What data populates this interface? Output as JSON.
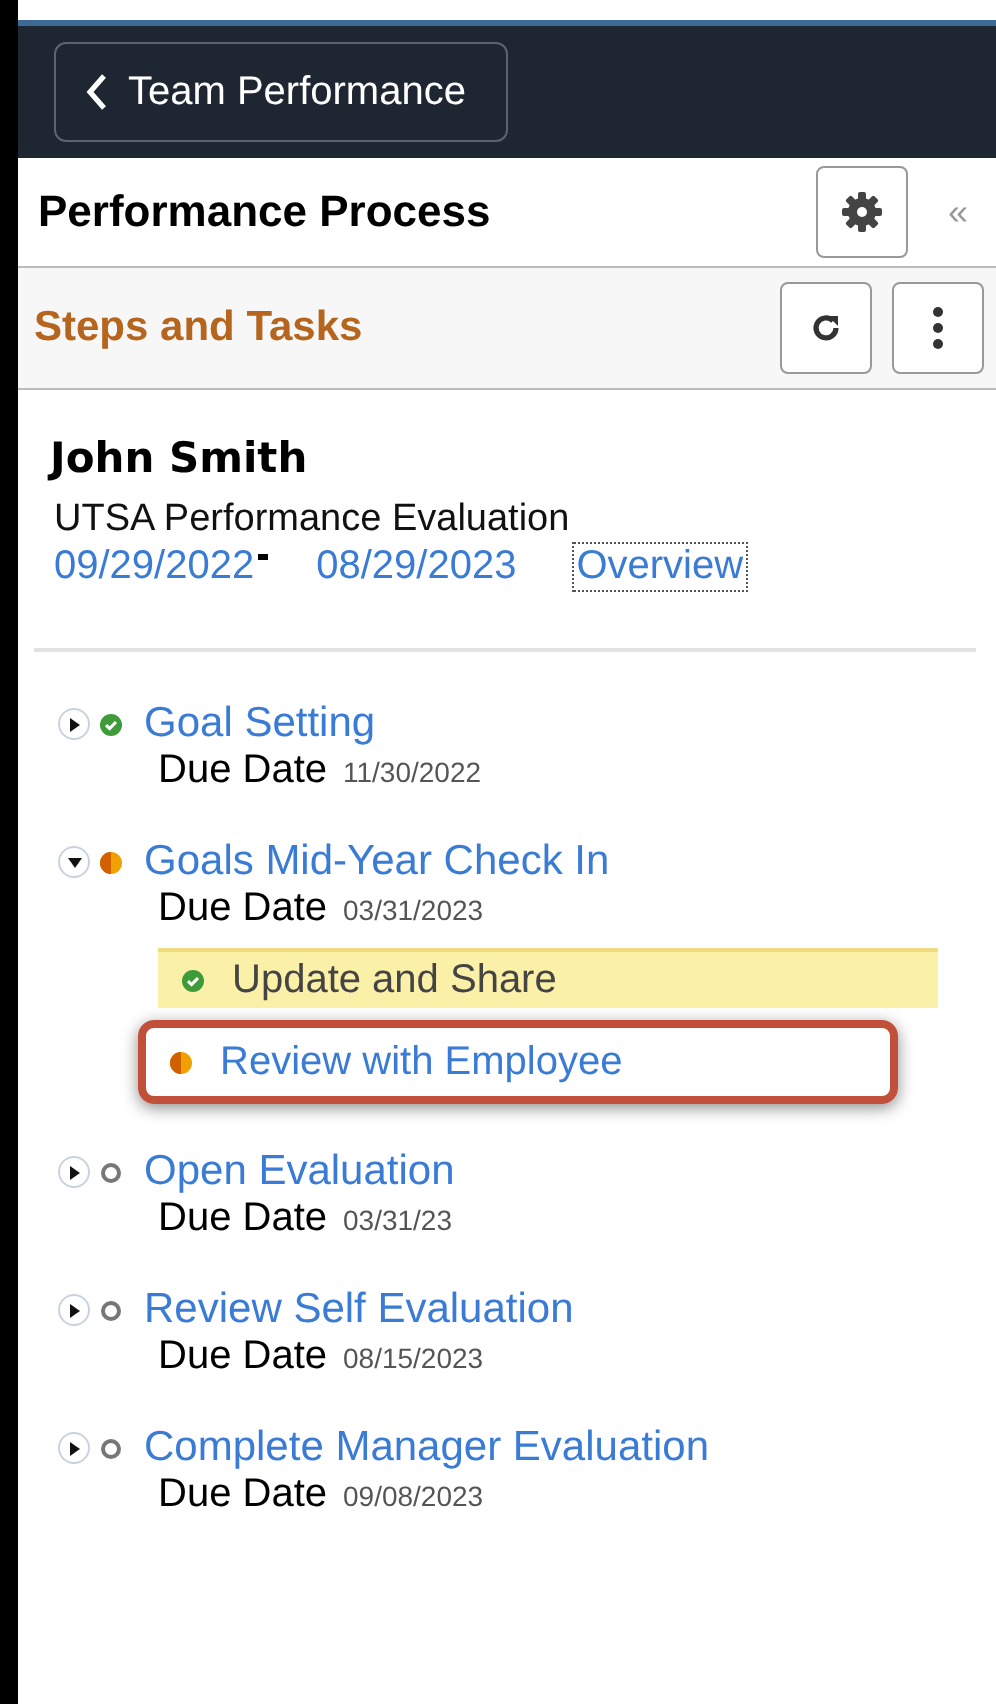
{
  "header": {
    "back_label": "Team Performance"
  },
  "panel": {
    "title": "Performance Process",
    "collapse_glyph": "«"
  },
  "section": {
    "title": "Steps and Tasks"
  },
  "employee": {
    "name": "John Smith",
    "document": "UTSA Performance Evaluation",
    "start_date": "09/29/2022",
    "end_date": "08/29/2023",
    "link": "Overview"
  },
  "steps": [
    {
      "title": "Goal Setting",
      "kind": "complete",
      "expanded": false,
      "due_label": "Due Date",
      "due_date": "11/30/2022"
    },
    {
      "title": "Goals Mid-Year Check In",
      "kind": "partial",
      "expanded": true,
      "due_label": "Due Date",
      "due_date": "03/31/2023",
      "tasks": [
        {
          "title": "Update and Share",
          "kind": "complete",
          "selected": true,
          "callout": false
        },
        {
          "title": "Review with Employee",
          "kind": "partial",
          "selected": false,
          "callout": true
        }
      ]
    },
    {
      "title": "Open Evaluation",
      "kind": "pending",
      "expanded": false,
      "due_label": "Due Date",
      "due_date": "03/31/23"
    },
    {
      "title": "Review Self Evaluation",
      "kind": "pending",
      "expanded": false,
      "due_label": "Due Date",
      "due_date": "08/15/2023"
    },
    {
      "title": "Complete Manager Evaluation",
      "kind": "pending",
      "expanded": false,
      "due_label": "Due Date",
      "due_date": "09/08/2023"
    }
  ]
}
